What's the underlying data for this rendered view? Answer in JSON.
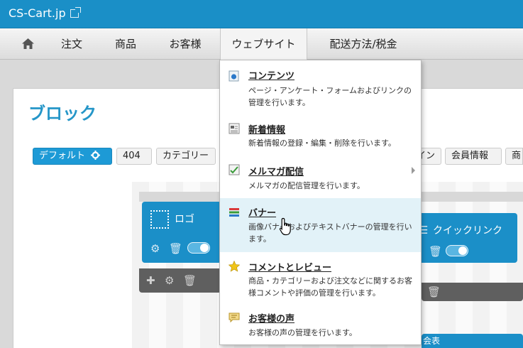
{
  "topbar": {
    "brand": "CS-Cart.jp",
    "brand_icon": "external-link-icon"
  },
  "nav": {
    "home_icon": "home-icon",
    "items": [
      "注文",
      "商品",
      "お客様",
      "ウェブサイト",
      "配送方法/税金"
    ],
    "active": "ウェブサイト"
  },
  "page": {
    "title": "ブロック",
    "tabs": [
      "デフォルト",
      "404",
      "カテゴリー",
      "イン",
      "会員情報",
      "商"
    ],
    "blocks": {
      "logo": "ロゴ",
      "quicklinks": "クイックリンク",
      "footer_partial": "会表"
    }
  },
  "menu": {
    "items": [
      {
        "icon": "contents-icon",
        "title": "コンテンツ",
        "desc": "ページ・アンケート・フォームおよびリンクの管理を行います。"
      },
      {
        "icon": "news-icon",
        "title": "新着情報",
        "desc": "新着情報の登録・編集・削除を行います。"
      },
      {
        "icon": "newsletter-icon",
        "title": "メルマガ配信",
        "desc": "メルマガの配信管理を行います。",
        "has_submenu": true
      },
      {
        "icon": "banner-icon",
        "title": "バナー",
        "desc": "画像バナーおよびテキストバナーの管理を行います。",
        "hovered": true
      },
      {
        "icon": "star-icon",
        "title": "コメントとレビュー",
        "desc": "商品・カテゴリーおよび注文などに関するお客様コメントや評価の管理を行います。"
      },
      {
        "icon": "testimonial-icon",
        "title": "お客様の声",
        "desc": "お客様の声の管理を行います。"
      }
    ]
  },
  "colors": {
    "accent": "#1a8fc7",
    "hover": "#e2f2f8",
    "block": "#1b8fc8"
  }
}
